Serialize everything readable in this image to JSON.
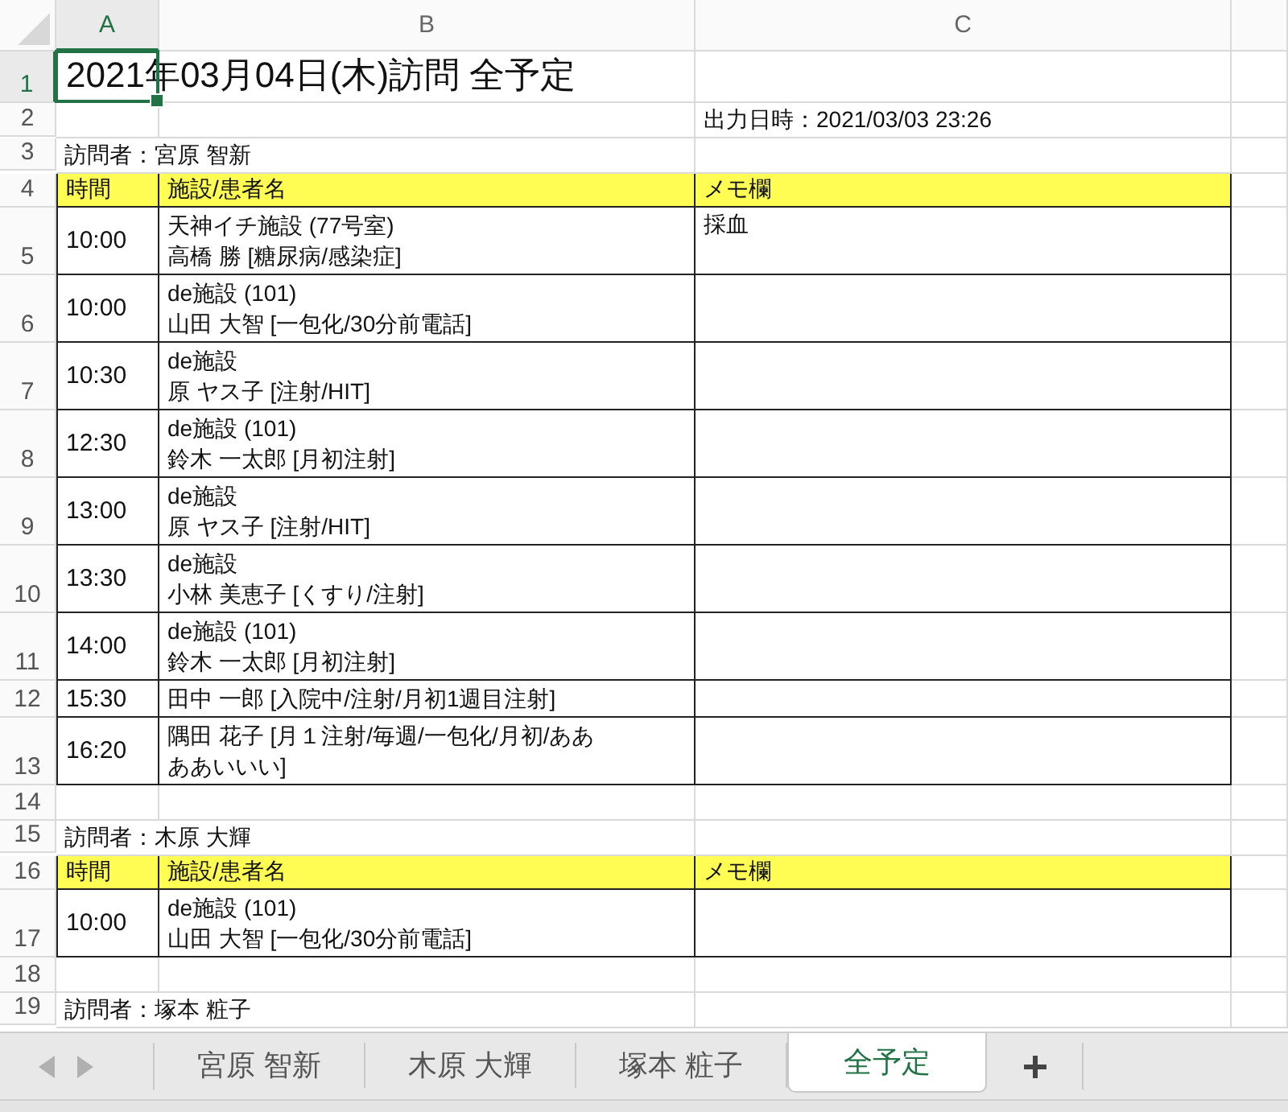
{
  "columns": [
    {
      "label": "A",
      "selected": true
    },
    {
      "label": "B",
      "selected": false
    },
    {
      "label": "C",
      "selected": false
    }
  ],
  "rows": [
    {
      "number": "1",
      "selected": true,
      "kind": "title",
      "text": "2021年03月04日(木)訪問 全予定"
    },
    {
      "number": "2",
      "selected": false,
      "kind": "meta",
      "timestamp": "出力日時：2021/03/03 23:26"
    },
    {
      "number": "3",
      "selected": false,
      "kind": "visitor",
      "text": "訪問者：宮原 智新"
    },
    {
      "number": "4",
      "selected": false,
      "kind": "header",
      "cells": [
        "時間",
        "施設/患者名",
        "メモ欄"
      ]
    },
    {
      "number": "5",
      "selected": false,
      "kind": "entry",
      "time": "10:00",
      "lines": [
        "天神イチ施設 (77号室)",
        "高橋 勝 [糖尿病/感染症]"
      ],
      "memo": "採血"
    },
    {
      "number": "6",
      "selected": false,
      "kind": "entry",
      "time": "10:00",
      "lines": [
        "de施設 (101)",
        "山田 大智 [一包化/30分前電話]"
      ]
    },
    {
      "number": "7",
      "selected": false,
      "kind": "entry",
      "time": "10:30",
      "lines": [
        "de施設",
        "原 ヤス子 [注射/HIT]"
      ]
    },
    {
      "number": "8",
      "selected": false,
      "kind": "entry",
      "time": "12:30",
      "lines": [
        "de施設 (101)",
        "鈴木 一太郎 [月初注射]"
      ]
    },
    {
      "number": "9",
      "selected": false,
      "kind": "entry",
      "time": "13:00",
      "lines": [
        "de施設",
        "原 ヤス子 [注射/HIT]"
      ]
    },
    {
      "number": "10",
      "selected": false,
      "kind": "entry",
      "time": "13:30",
      "lines": [
        "de施設",
        "小林 美恵子 [くすり/注射]"
      ]
    },
    {
      "number": "11",
      "selected": false,
      "kind": "entry",
      "time": "14:00",
      "lines": [
        "de施設 (101)",
        "鈴木 一太郎 [月初注射]"
      ]
    },
    {
      "number": "12",
      "selected": false,
      "kind": "entry",
      "time": "15:30",
      "lines": [
        "田中 一郎 [入院中/注射/月初1週目注射]"
      ]
    },
    {
      "number": "13",
      "selected": false,
      "kind": "entry",
      "time": "16:20",
      "lines": [
        "隅田 花子 [月１注射/毎週/一包化/月初/ああああいいい]"
      ]
    },
    {
      "number": "14",
      "selected": false,
      "kind": "blank"
    },
    {
      "number": "15",
      "selected": false,
      "kind": "visitor",
      "text": "訪問者：木原 大輝"
    },
    {
      "number": "16",
      "selected": false,
      "kind": "header",
      "cells": [
        "時間",
        "施設/患者名",
        "メモ欄"
      ]
    },
    {
      "number": "17",
      "selected": false,
      "kind": "entry",
      "time": "10:00",
      "lines": [
        "de施設 (101)",
        "山田 大智 [一包化/30分前電話]"
      ]
    },
    {
      "number": "18",
      "selected": false,
      "kind": "blank"
    },
    {
      "number": "19",
      "selected": false,
      "kind": "visitor",
      "text": "訪問者：塚本 粧子"
    }
  ],
  "sheet_tabs": [
    {
      "label": "宮原 智新",
      "selected": false
    },
    {
      "label": "木原 大輝",
      "selected": false
    },
    {
      "label": "塚本 粧子",
      "selected": false
    },
    {
      "label": "全予定",
      "selected": true
    }
  ]
}
